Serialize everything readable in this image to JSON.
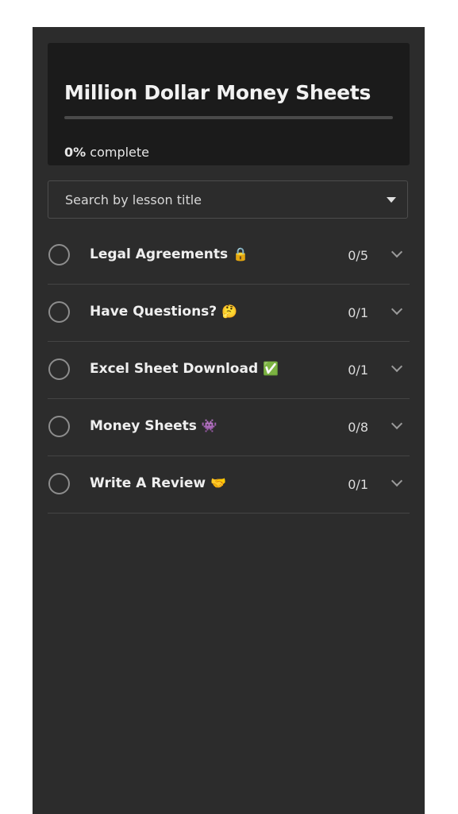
{
  "course": {
    "title": "Million Dollar Money Sheets",
    "progress_percent": "0%",
    "progress_suffix": "complete",
    "progress_fraction": 0
  },
  "search": {
    "placeholder": "Search by lesson title"
  },
  "lessons": [
    {
      "title": "Legal Agreements",
      "emoji": "🔒",
      "count": "0/5"
    },
    {
      "title": "Have Questions?",
      "emoji": "🤔",
      "count": "0/1"
    },
    {
      "title": "Excel Sheet Download",
      "emoji": "✅",
      "count": "0/1"
    },
    {
      "title": "Money Sheets",
      "emoji": "👾",
      "count": "0/8"
    },
    {
      "title": "Write A Review",
      "emoji": "🤝",
      "count": "0/1"
    }
  ],
  "colors": {
    "panel_bg": "#2c2c2c",
    "header_bg": "#1b1b1b",
    "progress_fill": "#5fb36b"
  }
}
